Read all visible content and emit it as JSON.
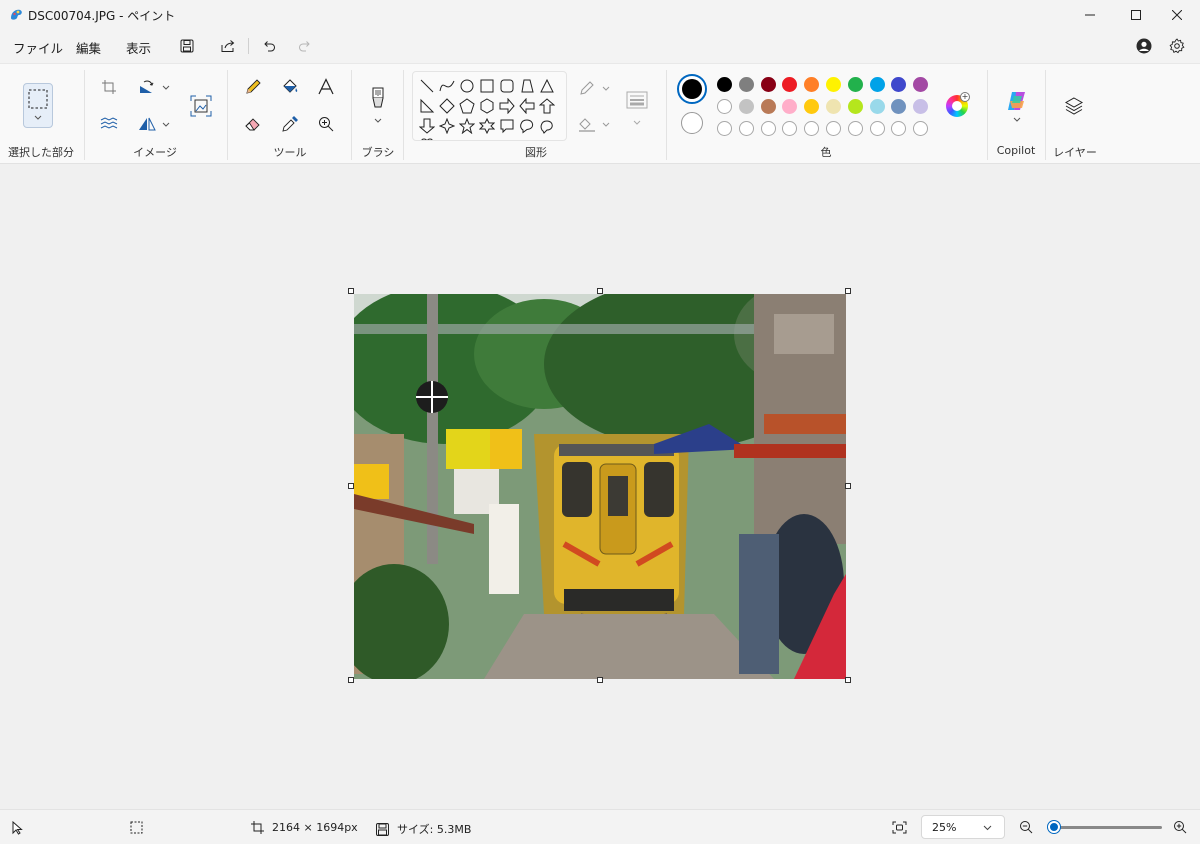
{
  "window": {
    "title": "DSC00704.JPG - ペイント"
  },
  "menu": {
    "file": "ファイル",
    "edit": "編集",
    "view": "表示"
  },
  "ribbon": {
    "groups": {
      "selection": "選択した部分",
      "image": "イメージ",
      "tools": "ツール",
      "brush": "ブラシ",
      "shapes": "図形",
      "colors": "色",
      "copilot": "Copilot",
      "layers": "レイヤー"
    },
    "colors": {
      "primary": "#000000",
      "secondary": "#ffffff",
      "row1": [
        "#000000",
        "#7f7f7f",
        "#880015",
        "#ed1c24",
        "#ff7f27",
        "#fff200",
        "#22b14c",
        "#00a2e8",
        "#3f48cc",
        "#a349a4"
      ],
      "row2": [
        "#ffffff",
        "#c3c3c3",
        "#b97a57",
        "#ffaec9",
        "#ffc90e",
        "#efe4b0",
        "#b5e61d",
        "#99d9ea",
        "#7092be",
        "#c8bfe7"
      ]
    }
  },
  "status": {
    "dimensions": "2164 × 1694px",
    "size": "サイズ: 5.3MB",
    "zoom": "25%",
    "zoom_level": 0.0
  }
}
